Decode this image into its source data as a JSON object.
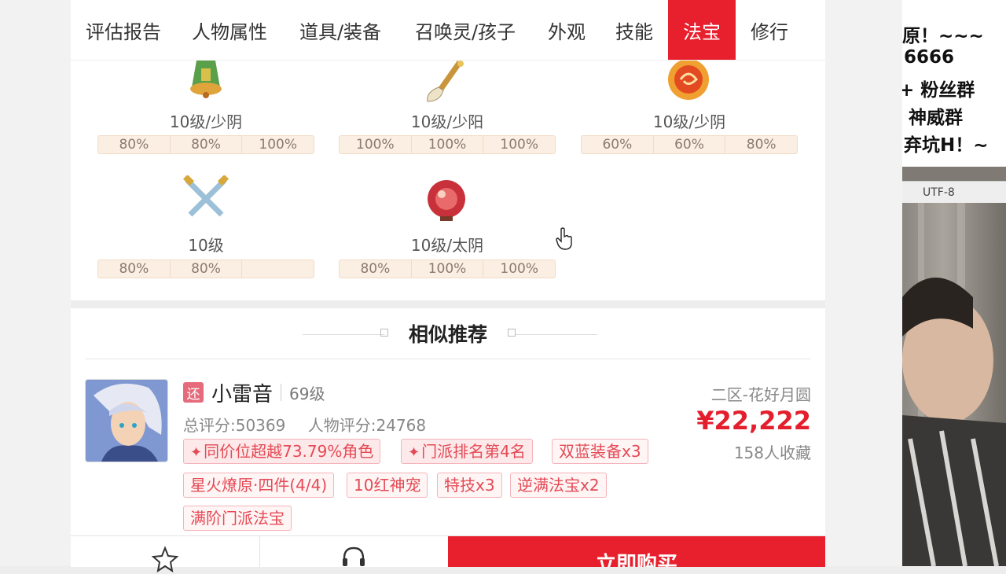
{
  "tabs": [
    {
      "label": "评估报告",
      "active": false
    },
    {
      "label": "人物属性",
      "active": false
    },
    {
      "label": "道具/装备",
      "active": false
    },
    {
      "label": "召唤灵/孩子",
      "active": false
    },
    {
      "label": "外观",
      "active": false
    },
    {
      "label": "技能",
      "active": false
    },
    {
      "label": "法宝",
      "active": true
    },
    {
      "label": "修行",
      "active": false
    }
  ],
  "treasures": [
    {
      "icon": "bell-icon",
      "label": "10级/少阴",
      "stats": [
        "80%",
        "80%",
        "100%"
      ]
    },
    {
      "icon": "brush-icon",
      "label": "10级/少阳",
      "stats": [
        "100%",
        "100%",
        "100%"
      ]
    },
    {
      "icon": "fire-orb-icon",
      "label": "10级/少阴",
      "stats": [
        "60%",
        "60%",
        "80%"
      ]
    },
    {
      "icon": "crossed-swords-icon",
      "label": "10级",
      "stats": [
        "80%",
        "80%",
        ""
      ]
    },
    {
      "icon": "red-gourd-icon",
      "label": "10级/太阴",
      "stats": [
        "80%",
        "100%",
        "100%"
      ]
    }
  ],
  "recommend": {
    "title": "相似推荐",
    "item": {
      "badge": "还",
      "name": "小雷音",
      "level": "69级",
      "total_score": "总评分:50369",
      "char_score": "人物评分:24768",
      "server": "二区-花好月圆",
      "price": "¥22,222",
      "favorites": "158人收藏",
      "tags": [
        "同价位超越73.79%角色",
        "门派排名第4名",
        "双蓝装备x3",
        "星火燎原·四件(4/4)",
        "10红神宠",
        "特技x3",
        "逆满法宝x2",
        "满阶门派法宝"
      ]
    }
  },
  "bottom": {
    "buy_label": "立即购买"
  },
  "overlay": {
    "chat_lines": [
      "原！~~~",
      "6666",
      "+ 粉丝群",
      "神威群",
      "弃坑H！~"
    ],
    "encoding": "UTF-8"
  },
  "colors": {
    "accent": "#e8202e",
    "tag_text": "#e44a55",
    "price": "#e41e2c"
  }
}
